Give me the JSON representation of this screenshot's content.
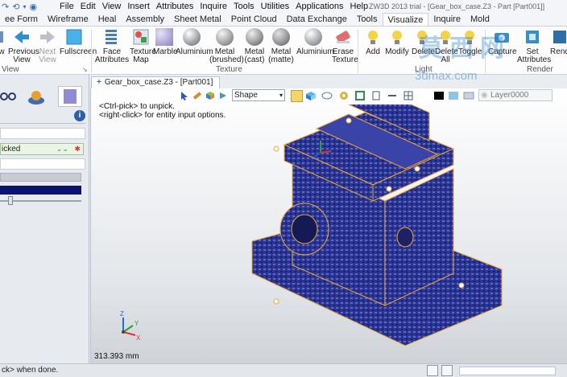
{
  "menubar": {
    "items": [
      "File",
      "Edit",
      "View",
      "Insert",
      "Attributes",
      "Inquire",
      "Tools",
      "Utilities",
      "Applications",
      "Help"
    ],
    "app_title": "ZW3D 2013 trial  - [Gear_box_case.Z3 - Part [Part001]]"
  },
  "ribbon_tabs": {
    "items": [
      "ee Form",
      "Wireframe",
      "Heal",
      "Assembly",
      "Sheet Metal",
      "Point Cloud",
      "Data Exchange",
      "Tools",
      "Visualize",
      "Inquire",
      "Mold"
    ],
    "active": "Visualize"
  },
  "ribbon": {
    "view_group": {
      "label": "View",
      "buttons": [
        {
          "line1": "w",
          "line2": ""
        },
        {
          "line1": "Previous",
          "line2": "View"
        },
        {
          "line1": "Next",
          "line2": "View"
        },
        {
          "line1": "Fullscreen",
          "line2": ""
        }
      ]
    },
    "texture_group": {
      "label": "Texture",
      "buttons": [
        {
          "line1": "Face",
          "line2": "Attributes"
        },
        {
          "line1": "Texture",
          "line2": "Map"
        },
        {
          "line1": "Marble",
          "line2": ""
        },
        {
          "line1": "Aluminium",
          "line2": ""
        },
        {
          "line1": "Metal",
          "line2": "(brushed)"
        },
        {
          "line1": "Metal",
          "line2": "(cast)"
        },
        {
          "line1": "Metal",
          "line2": "(matte)"
        },
        {
          "line1": "Aluminium",
          "line2": ""
        },
        {
          "line1": "Erase",
          "line2": "Texture"
        }
      ]
    },
    "light_group": {
      "label": "Light",
      "buttons": [
        {
          "line1": "Add",
          "line2": ""
        },
        {
          "line1": "Modify",
          "line2": ""
        },
        {
          "line1": "Delete",
          "line2": ""
        },
        {
          "line1": "Delete",
          "line2": "All"
        },
        {
          "line1": "Toggle",
          "line2": ""
        }
      ]
    },
    "render_group": {
      "label": "Render",
      "buttons": [
        {
          "line1": "Capture",
          "line2": ""
        },
        {
          "line1": "Set",
          "line2": "Attributes"
        },
        {
          "line1": "Rend",
          "line2": ""
        }
      ]
    },
    "watermark": "3dmax.com"
  },
  "left_panel": {
    "picked_value": "icked",
    "info_label": "i"
  },
  "document": {
    "tab_title": "Gear_box_case.Z3 - [Part001]"
  },
  "viewport": {
    "filter_value": "Shape",
    "layer_value": "Layer0000",
    "hint_line1": "<Ctrl-pick> to unpick.",
    "hint_line2": "<right-click> for entity input options.",
    "coordinate": "313.393 mm",
    "axis_labels": [
      "Z",
      "Y",
      "X"
    ]
  },
  "statusbar": {
    "message": "ck> when done."
  },
  "colors": {
    "accent": "#3a6ea5",
    "model_blue": "#2a3494",
    "edge_orange": "#f2a634"
  }
}
